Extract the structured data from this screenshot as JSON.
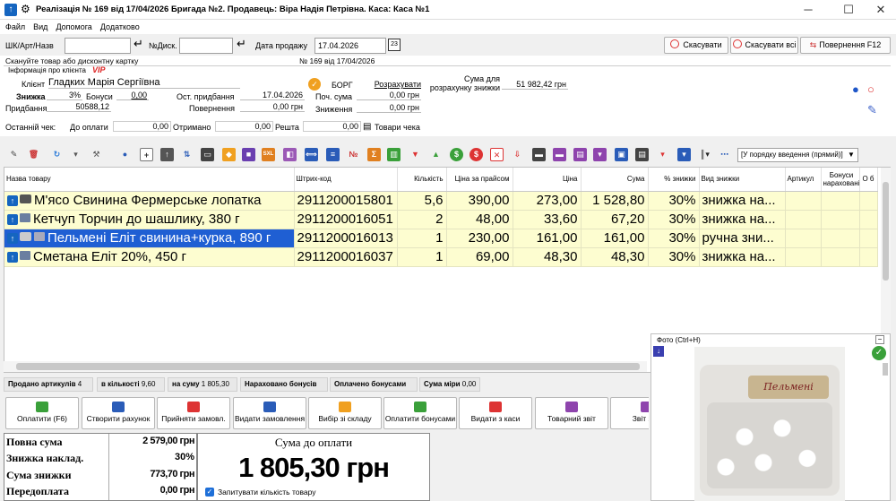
{
  "window": {
    "title": "Реалізація № 169 від 17/04/2026 Бригада №2. Продавець: Віра Надія Петрівна. Каса: Каса №1",
    "min": "─",
    "max": "☐",
    "close": "✕"
  },
  "menu": [
    "Файл",
    "Вид",
    "Допомога",
    "Додатково"
  ],
  "search": {
    "barcode_label": "ШК/Арт/Назв",
    "disc_label": "№Диск.",
    "date_label": "Дата продажу",
    "date_value": "17.04.2026",
    "enter_glyph": "↵"
  },
  "top_buttons": {
    "cancel": "Скасувати",
    "cancel_all": "Скасувати всі",
    "return": "Повернення F12"
  },
  "info": {
    "scan_hint": "Скануйте товар або дисконтну картку",
    "doc_number": "№ 169 від 17/04/2026",
    "client_info_label": "Інформація про клієнта",
    "vip": "VIP",
    "client_label": "Клієнт",
    "client_name": "Гладких Марія Сергіївна",
    "discount_label": "Знижка",
    "discount_value": "3%",
    "bonus_label": "Бонуси",
    "bonus_value": "0,00",
    "last_purchase_label": "Ост. придбання",
    "last_purchase_value": "17.04.2026",
    "purchases_label": "Придбання",
    "purchases_value": "50588,12",
    "returns_label": "Повернення",
    "returns_value": "0,00 грн",
    "debt_label": "БОРГ",
    "pay_link": "Розрахувати",
    "start_sum_label": "Поч. сума",
    "start_sum_value": "0,00 грн",
    "decrease_label": "Зниження",
    "decrease_value": "0,00 грн",
    "calc_sum_label": "Сума для розрахунку знижки",
    "calc_sum_value": "51 982,42 грн"
  },
  "lastcheck": {
    "label": "Останній чек:",
    "to_pay_label": "До оплати",
    "to_pay_value": "0,00",
    "received_label": "Отримано",
    "received_value": "0,00",
    "change_label": "Решта",
    "change_value": "0,00",
    "goods_label": "Товари чека"
  },
  "order_select": "[У порядку введення (прямий)]",
  "grid": {
    "headers": [
      "Назва товару",
      "Штрих-код",
      "Кількість",
      "Ціна за прайсом",
      "Ціна",
      "Сума",
      "% знижки",
      "Вид знижки",
      "Артикул",
      "Бонуси нараховані",
      "О б"
    ],
    "rows": [
      {
        "name": "М'ясо Свинина Фермерське лопатка",
        "barcode": "2911200015801",
        "qty": "5,6",
        "price_list": "390,00",
        "price": "273,00",
        "sum": "1 528,80",
        "disc_pct": "30%",
        "disc_kind": "знижка на..."
      },
      {
        "name": "Кетчуп Торчин до шашлику, 380 г",
        "barcode": "2911200016051",
        "qty": "2",
        "price_list": "48,00",
        "price": "33,60",
        "sum": "67,20",
        "disc_pct": "30%",
        "disc_kind": "знижка на..."
      },
      {
        "name": "Пельмені Еліт свинина+курка, 890 г",
        "barcode": "2911200016013",
        "qty": "1",
        "price_list": "230,00",
        "price": "161,00",
        "sum": "161,00",
        "disc_pct": "30%",
        "disc_kind": "ручна зни..."
      },
      {
        "name": "Сметана Еліт 20%, 450 г",
        "barcode": "2911200016037",
        "qty": "1",
        "price_list": "69,00",
        "price": "48,30",
        "sum": "48,30",
        "disc_pct": "30%",
        "disc_kind": "знижка на..."
      }
    ]
  },
  "photo": {
    "label": "Фото (Ctrl+H)",
    "package_text": "Пельмені"
  },
  "status": {
    "sold_label": "Продано артикулів",
    "sold_value": "4",
    "qty_label": "в кількості",
    "qty_value": "9,60",
    "sum_label": "на суму",
    "sum_value": "1 805,30",
    "bonus_acc": "Нараховано бонусів",
    "bonus_paid": "Оплачено бонусами",
    "measure_label": "Сума міри",
    "measure_value": "0,00"
  },
  "actions": [
    "Оплатити (F6)",
    "Створити рахунок",
    "Прийняти замовл.",
    "Видати замовлення",
    "Вибір зі складу",
    "Оплатити бонусами",
    "Видати з каси",
    "Товарний звіт",
    "Звіт за к"
  ],
  "totals": {
    "full_label": "Повна сума",
    "full_value": "2 579,00 грн",
    "inv_disc_label": "Знижка наклад.",
    "inv_disc_value": "30%",
    "disc_sum_label": "Сума знижки",
    "disc_sum_value": "773,70 грн",
    "prepay_label": "Передоплата",
    "prepay_value": "0,00 грн"
  },
  "to_pay": {
    "label": "Сума до оплати",
    "value": "1 805,30 грн",
    "ask_qty": "Запитувати кількість товару"
  }
}
